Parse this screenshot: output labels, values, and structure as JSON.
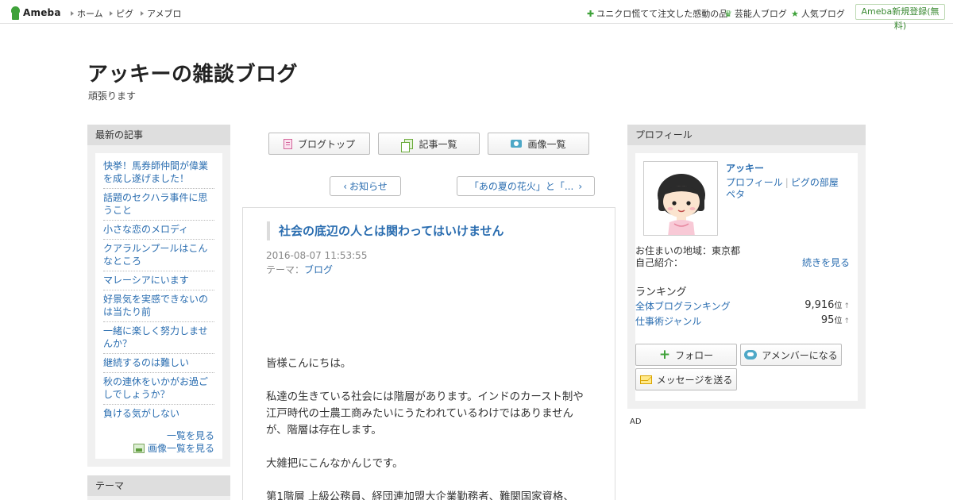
{
  "topbar": {
    "logo_text": "Ameba",
    "nav": [
      "ホーム",
      "ピグ",
      "アメブロ"
    ],
    "links": [
      {
        "icon": "sparkle-icon",
        "label": "ユニクロ慌てて注文した感動の品"
      },
      {
        "icon": "crown-icon",
        "label": "芸能人ブログ"
      },
      {
        "icon": "star-icon",
        "label": "人気ブログ"
      }
    ],
    "register_label": "Ameba新規登録(無料)"
  },
  "blog": {
    "title": "アッキーの雑談ブログ",
    "description": "頑張ります"
  },
  "recent": {
    "heading": "最新の記事",
    "items": [
      "快挙！馬券師仲間が偉業を成し遂げました！",
      "話題のセクハラ事件に思うこと",
      "小さな恋のメロディ",
      "クアラルンプールはこんなところ",
      "マレーシアにいます",
      "好景気を実感できないのは当たり前",
      "一緒に楽しく努力しませんか？",
      "継続するのは難しい",
      "秋の連休をいかがお過ごしでしょうか？",
      "負ける気がしない"
    ],
    "see_all": "一覧を見る",
    "see_images": "画像一覧を見る"
  },
  "theme_box": {
    "heading": "テーマ"
  },
  "blognav": {
    "top": "ブログトップ",
    "list": "記事一覧",
    "images": "画像一覧"
  },
  "pager": {
    "prev": "お知らせ",
    "next": "「あの夏の花火」と「..."
  },
  "article": {
    "title": "社会の底辺の人とは関わってはいけません",
    "date": "2016-08-07 11:53:55",
    "theme_label": "テーマ：",
    "theme": "ブログ",
    "paragraphs": [
      "皆様こんにちは。",
      "私達の生きている社会には階層があります。インドのカースト制や江戸時代の士農工商みたいにうたわれているわけではありませんが、階層は存在します。",
      "大雑把にこんなかんじです。",
      "第1階層 上級公務員、経団連加盟大企業勤務者、難関国家資格、"
    ]
  },
  "profile": {
    "heading": "プロフィール",
    "name": "アッキー",
    "link_profile": "プロフィール",
    "link_pig": "ピグの部屋",
    "link_peta": "ペタ",
    "area": "お住まいの地域：東京都",
    "intro_label": "自己紹介：",
    "read_more": "続きを見る",
    "ranking_heading": "ランキング",
    "rankings": [
      {
        "label": "全体ブログランキング",
        "value": "9,916",
        "unit": "位",
        "trend": "↑"
      },
      {
        "label": "仕事術ジャンル",
        "value": "95",
        "unit": "位",
        "trend": "↑"
      }
    ],
    "follow": "フォロー",
    "amember": "アメンバーになる",
    "message": "メッセージを送る"
  },
  "ad_label": "AD"
}
